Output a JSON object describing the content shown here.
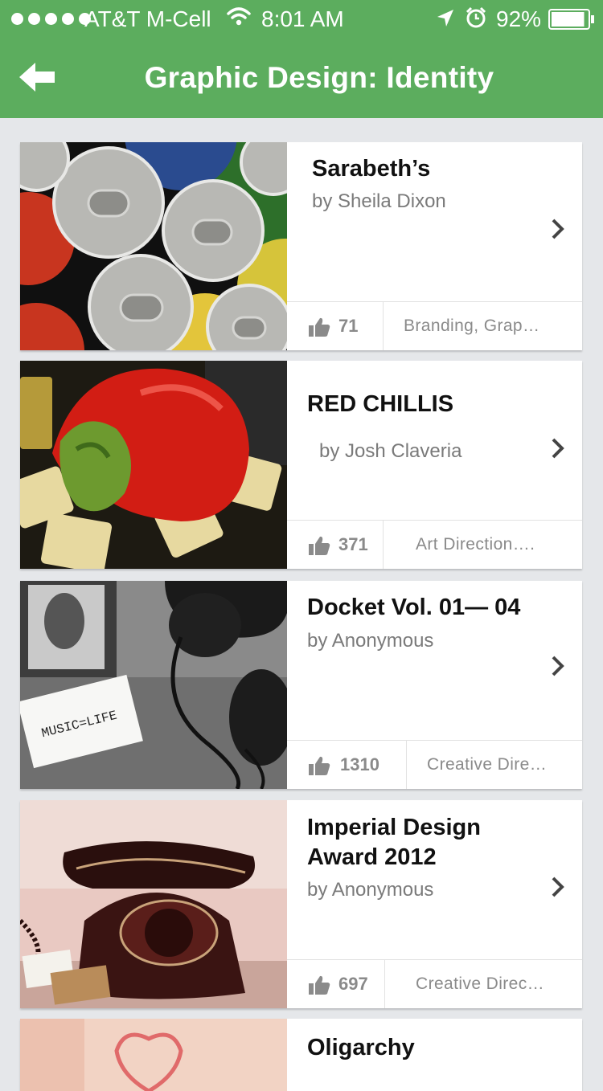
{
  "status": {
    "carrier": "AT&T M-Cell",
    "time": "8:01 AM",
    "battery": "92%",
    "battery_level": 0.92
  },
  "nav": {
    "title": "Graphic Design: Identity"
  },
  "projects": [
    {
      "title": "Sarabeth’s",
      "author": "by  Sheila Dixon",
      "likes": "71",
      "tags": "Branding, Grap…"
    },
    {
      "title": "RED CHILLIS",
      "author": "by Josh Claveria",
      "likes": "371",
      "tags": "Art Direction…."
    },
    {
      "title": "Docket Vol. 01— 04",
      "author": "by Anonymous",
      "likes": "1310",
      "tags": "Creative Dire…"
    },
    {
      "title_line1": "Imperial Design",
      "title_line2": "Award 2012",
      "author": "by Anonymous",
      "likes": "697",
      "tags": "Creative Direc…"
    },
    {
      "title": "Oligarchy"
    }
  ],
  "thumb_text": {
    "music_note": "MUSIC=LIFE"
  },
  "colors": {
    "accent": "#5cad5e",
    "background": "#e5e7ea"
  }
}
